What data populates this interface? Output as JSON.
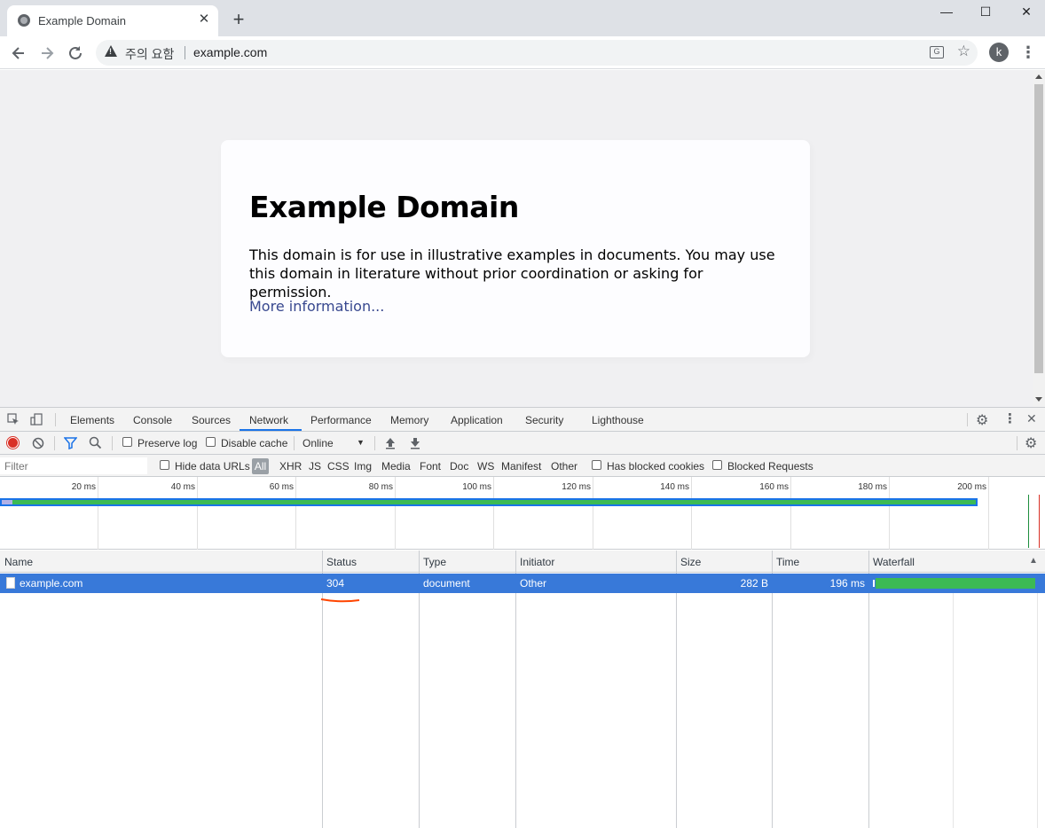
{
  "browser": {
    "tab_title": "Example Domain",
    "new_tab": "+",
    "window_controls": {
      "minimize": "—",
      "maximize": "☐",
      "close": "✕"
    },
    "security_label": "주의 요함",
    "url": "example.com",
    "avatar_letter": "k"
  },
  "page": {
    "heading": "Example Domain",
    "paragraph": "This domain is for use in illustrative examples in documents. You may use this domain in literature without prior coordination or asking for permission.",
    "link": "More information..."
  },
  "devtools": {
    "tabs": [
      "Elements",
      "Console",
      "Sources",
      "Network",
      "Performance",
      "Memory",
      "Application",
      "Security",
      "Lighthouse"
    ],
    "active_tab": "Network",
    "toolbar": {
      "preserve_log": "Preserve log",
      "disable_cache": "Disable cache",
      "throttle": "Online"
    },
    "filterbar": {
      "filter_placeholder": "Filter",
      "hide_data_urls": "Hide data URLs",
      "types": [
        "All",
        "XHR",
        "JS",
        "CSS",
        "Img",
        "Media",
        "Font",
        "Doc",
        "WS",
        "Manifest",
        "Other"
      ],
      "has_blocked_cookies": "Has blocked cookies",
      "blocked_requests": "Blocked Requests"
    },
    "overview_ticks": [
      "20 ms",
      "40 ms",
      "60 ms",
      "80 ms",
      "100 ms",
      "120 ms",
      "140 ms",
      "160 ms",
      "180 ms",
      "200 ms"
    ],
    "columns": [
      "Name",
      "Status",
      "Type",
      "Initiator",
      "Size",
      "Time",
      "Waterfall"
    ],
    "rows": [
      {
        "name": "example.com",
        "status": "304",
        "type": "document",
        "initiator": "Other",
        "size": "282 B",
        "time": "196 ms"
      }
    ],
    "colors": {
      "selected_row": "#3879d9",
      "waterfall_bar": "#3cba54",
      "accent": "#1a73e8",
      "annotation": "#ff4500"
    }
  }
}
